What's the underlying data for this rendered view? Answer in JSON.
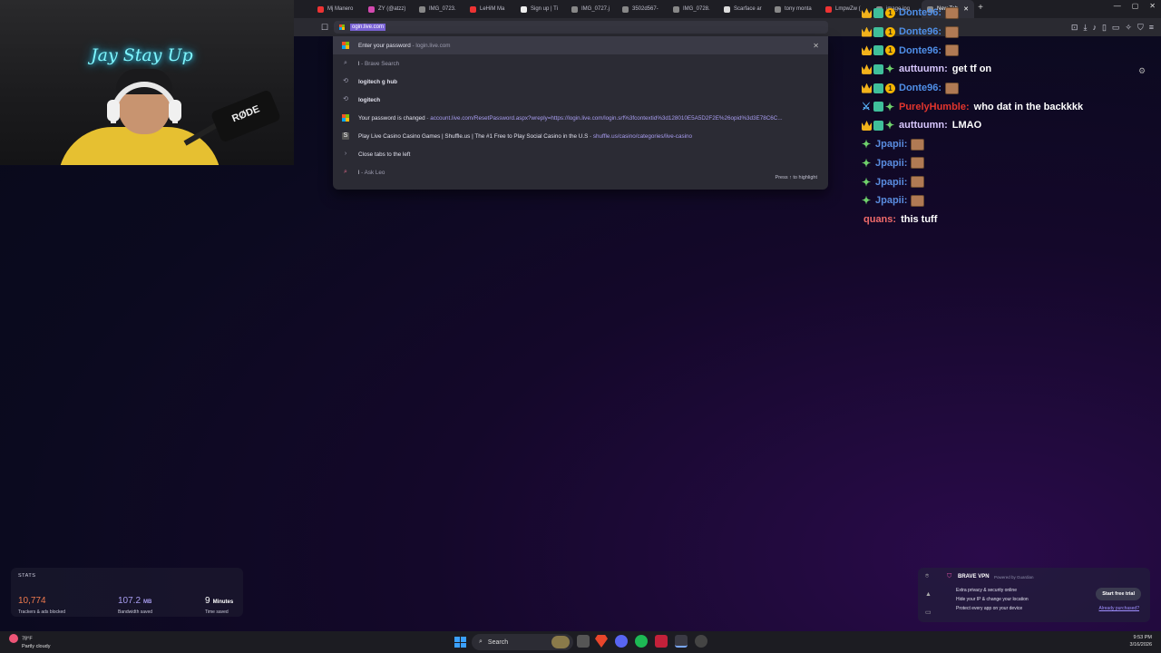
{
  "webcam": {
    "neon_sign": "Jay Stay Up",
    "mic_brand": "RØDE"
  },
  "browser": {
    "tabs": [
      {
        "label": "Mj Manero",
        "color": "#e33"
      },
      {
        "label": "ZY (@atzz)",
        "color": "#d349b0"
      },
      {
        "label": "IMG_0723.",
        "color": "#888"
      },
      {
        "label": "LeHiM Ma",
        "color": "#e33"
      },
      {
        "label": "Sign up | Ti",
        "color": "#eee"
      },
      {
        "label": "IMG_0727.j",
        "color": "#888"
      },
      {
        "label": "3502d567-",
        "color": "#888"
      },
      {
        "label": "IMG_0728.",
        "color": "#888"
      },
      {
        "label": "Scarface ar",
        "color": "#ddd"
      },
      {
        "label": "tony monta",
        "color": "#888"
      },
      {
        "label": "LmpwZw (",
        "color": "#e33"
      },
      {
        "label": "image.jpg",
        "color": "#888"
      },
      {
        "label": "New Tab",
        "color": "#888",
        "active": true
      }
    ],
    "url": "ogin.live.com"
  },
  "omnibox": {
    "suggestions": [
      {
        "icon": "microsoft",
        "title": "Enter your password",
        "sep": " - ",
        "detail": "login.live.com"
      },
      {
        "icon": "search",
        "title": "l",
        "sep": " - ",
        "detail": "Brave Search"
      },
      {
        "icon": "history",
        "title": "logitech g hub",
        "bold": true
      },
      {
        "icon": "history",
        "title": "logitech",
        "bold": true
      },
      {
        "icon": "microsoft",
        "title": "Your password is changed",
        "sep": " - ",
        "detail": "account.live.com/ResetPassword.aspx?wreply=https://login.live.com/login.srf%3fcontextid%3d128010E5A5D2F2E%26opid%3d3E78C6C...",
        "link": true
      },
      {
        "icon": "shuffle",
        "title": "Play Live Casino Casino Games | Shuffle.us | The #1 Free to Play Social Casino in the U.S",
        "sep": " - ",
        "detail": "shuffle.us/casino/categories/live-casino",
        "link": true
      },
      {
        "icon": "chevron",
        "title": "Close tabs to the left"
      },
      {
        "icon": "leo",
        "title": "l",
        "sep": " - ",
        "detail": "Ask Leo"
      }
    ],
    "hint": "Press ↑ to highlight"
  },
  "stats": {
    "title": "STATS",
    "items": [
      {
        "value": "10,774",
        "unit": "",
        "label": "Trackers & ads blocked",
        "color": "#f07a4e"
      },
      {
        "value": "107.2",
        "unit": "MB",
        "label": "Bandwidth saved",
        "color": "#a89df0"
      },
      {
        "value": "9",
        "unit": "Minutes",
        "label": "Time saved",
        "color": "#ffffff"
      }
    ]
  },
  "vpn": {
    "title": "BRAVE VPN",
    "powered": "Powered by Guardian",
    "features": [
      "Extra privacy & security online",
      "Hide your IP & change your location",
      "Protect every app on your device"
    ],
    "cta": "Start free trial",
    "link": "Already purchased?"
  },
  "chat": [
    {
      "badges": [
        "crown",
        "bits",
        "one"
      ],
      "user": "Donte96:",
      "color": "#4f8fe8",
      "text": "",
      "emote": true
    },
    {
      "badges": [
        "crown",
        "bits",
        "one"
      ],
      "user": "Donte96:",
      "color": "#4f8fe8",
      "text": "",
      "emote": true
    },
    {
      "badges": [
        "crown",
        "bits",
        "one"
      ],
      "user": "Donte96:",
      "color": "#4f8fe8",
      "text": "",
      "emote": true
    },
    {
      "badges": [
        "crown",
        "bits",
        "star"
      ],
      "user": "auttuumn:",
      "color": "#d9c8ff",
      "text": "get tf on",
      "emote": false
    },
    {
      "badges": [
        "crown",
        "bits",
        "one"
      ],
      "user": "Donte96:",
      "color": "#4f8fe8",
      "text": "",
      "emote": true
    },
    {
      "badges": [
        "sword",
        "bits",
        "star"
      ],
      "user": "PurelyHumble:",
      "color": "#e3352d",
      "text": "who dat in the backkkk",
      "emote": false
    },
    {
      "badges": [
        "crown",
        "bits",
        "star"
      ],
      "user": "auttuumn:",
      "color": "#d9c8ff",
      "text": "LMAO",
      "emote": false
    },
    {
      "badges": [
        "star"
      ],
      "user": "Jpapii:",
      "color": "#5a8de0",
      "text": "",
      "emote": true
    },
    {
      "badges": [
        "star"
      ],
      "user": "Jpapii:",
      "color": "#5a8de0",
      "text": "",
      "emote": true
    },
    {
      "badges": [
        "star"
      ],
      "user": "Jpapii:",
      "color": "#5a8de0",
      "text": "",
      "emote": true
    },
    {
      "badges": [
        "star"
      ],
      "user": "Jpapii:",
      "color": "#5a8de0",
      "text": "",
      "emote": true
    },
    {
      "badges": [],
      "user": "quans:",
      "color": "#f06a6a",
      "text": "this tuff",
      "emote": false
    }
  ],
  "taskbar": {
    "temp": "78°F",
    "weather": "Partly cloudy",
    "search": "Search",
    "time": "9:53 PM",
    "date": "3/16/2026"
  }
}
